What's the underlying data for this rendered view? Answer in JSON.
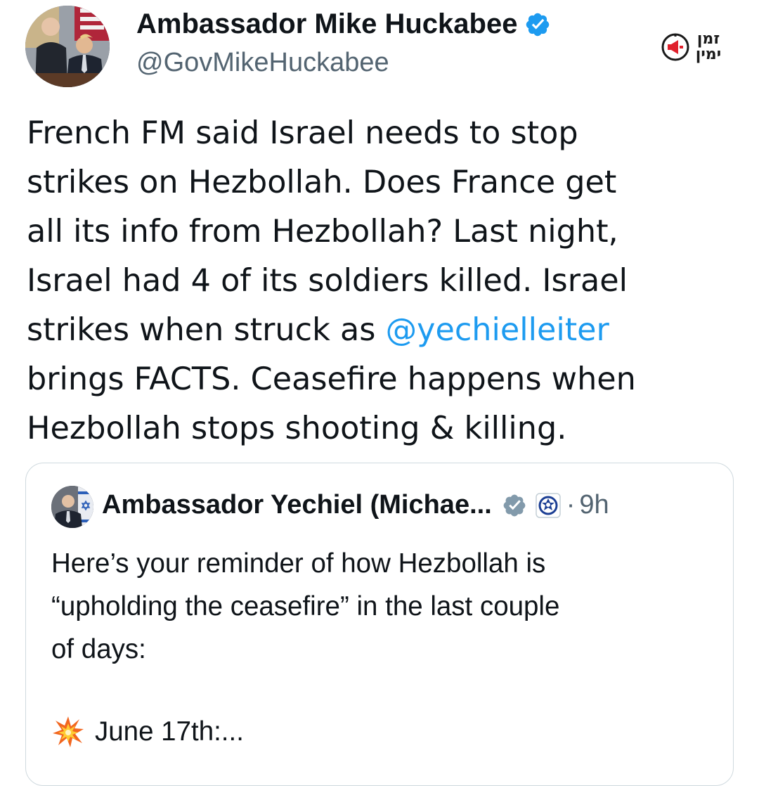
{
  "tweet": {
    "author": {
      "name": "Ambassador Mike Huckabee",
      "handle": "@GovMikeHuckabee",
      "verified": true
    },
    "text_lines": [
      {
        "text": "French FM said Israel needs to stop"
      },
      {
        "text": "strikes on Hezbollah. Does France get"
      },
      {
        "text": "all its info from Hezbollah? Last night,"
      },
      {
        "text": "Israel had 4 of its soldiers killed. Israel"
      },
      {
        "before": "strikes when struck as ",
        "mention": "@yechielleiter"
      },
      {
        "text": "brings FACTS. Ceasefire happens when"
      },
      {
        "text": "Hezbollah stops shooting & killing."
      }
    ]
  },
  "quote": {
    "author": {
      "name": "Ambassador Yechiel (Michae...",
      "verified": true,
      "separator": "·",
      "time": "9h"
    },
    "text_lines": [
      "Here’s your reminder of how Hezbollah is",
      "“upholding the ceasefire” in the last couple",
      "of days:"
    ],
    "more": {
      "icon": "collision-icon",
      "text": "June 17th:..."
    }
  },
  "watermark": {
    "text_line1": "זמן",
    "text_line2": "ימין",
    "icon": "megaphone-clock-icon"
  },
  "colors": {
    "text": "#0f1419",
    "secondary": "#536471",
    "link": "#1d9bf0",
    "verified": "#1d9bf0",
    "quote_border": "#cfd9de",
    "quote_verified": "#829aab"
  }
}
